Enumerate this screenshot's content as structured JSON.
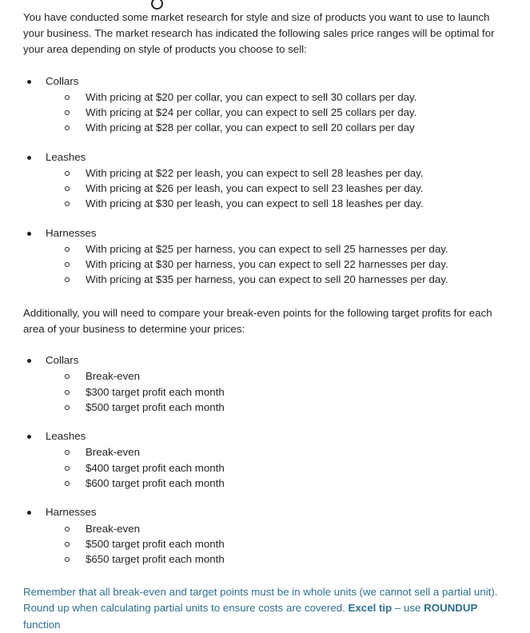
{
  "document": {
    "top_glyph": "hollow-circle-bullet-clipped",
    "intro_paragraph": "You have conducted some market research for style and size of products you want to use to launch your business. The market research has indicated the following sales price ranges will be optimal for your area depending on style of products you choose to sell:",
    "pricing_groups": [
      {
        "label": "Collars",
        "items": [
          "With pricing at $20 per collar, you can expect to sell 30 collars per day.",
          "With pricing at $24 per collar, you can expect to sell 25 collars per day.",
          "With pricing at $28 per collar, you can expect to sell 20 collars per day"
        ]
      },
      {
        "label": "Leashes",
        "items": [
          "With pricing at $22 per leash, you can expect to sell 28 leashes per day.",
          "With pricing at $26 per leash, you can expect to sell 23 leashes per day.",
          "With pricing at $30 per leash, you can expect to sell 18 leashes per day."
        ]
      },
      {
        "label": "Harnesses",
        "items": [
          "With pricing at $25 per harness, you can expect to sell 25 harnesses per day.",
          "With pricing at $30 per harness, you can expect to sell 22 harnesses per day.",
          "With pricing at $35 per harness, you can expect to sell 20 harnesses per day."
        ]
      }
    ],
    "additionally_paragraph": "Additionally, you will need to compare your break-even points for the following target profits for each area of your business to determine your prices:",
    "target_groups": [
      {
        "label": "Collars",
        "items": [
          "Break-even",
          "$300 target profit each month",
          "$500 target profit each month"
        ]
      },
      {
        "label": "Leashes",
        "items": [
          "Break-even",
          "$400 target profit each month",
          "$600 target profit each month"
        ]
      },
      {
        "label": "Harnesses",
        "items": [
          "Break-even",
          "$500 target profit each month",
          "$650 target profit each month"
        ]
      }
    ],
    "note": {
      "color": "#2e6e8e",
      "text_part1": "Remember that all break-even and target points must be in whole units (we cannot sell a partial unit).  Round up when calculating partial units to ensure costs are covered.  ",
      "bold1": "Excel tip",
      "text_part2": " – use ",
      "bold2": "ROUNDUP",
      "text_part3": " function"
    }
  }
}
